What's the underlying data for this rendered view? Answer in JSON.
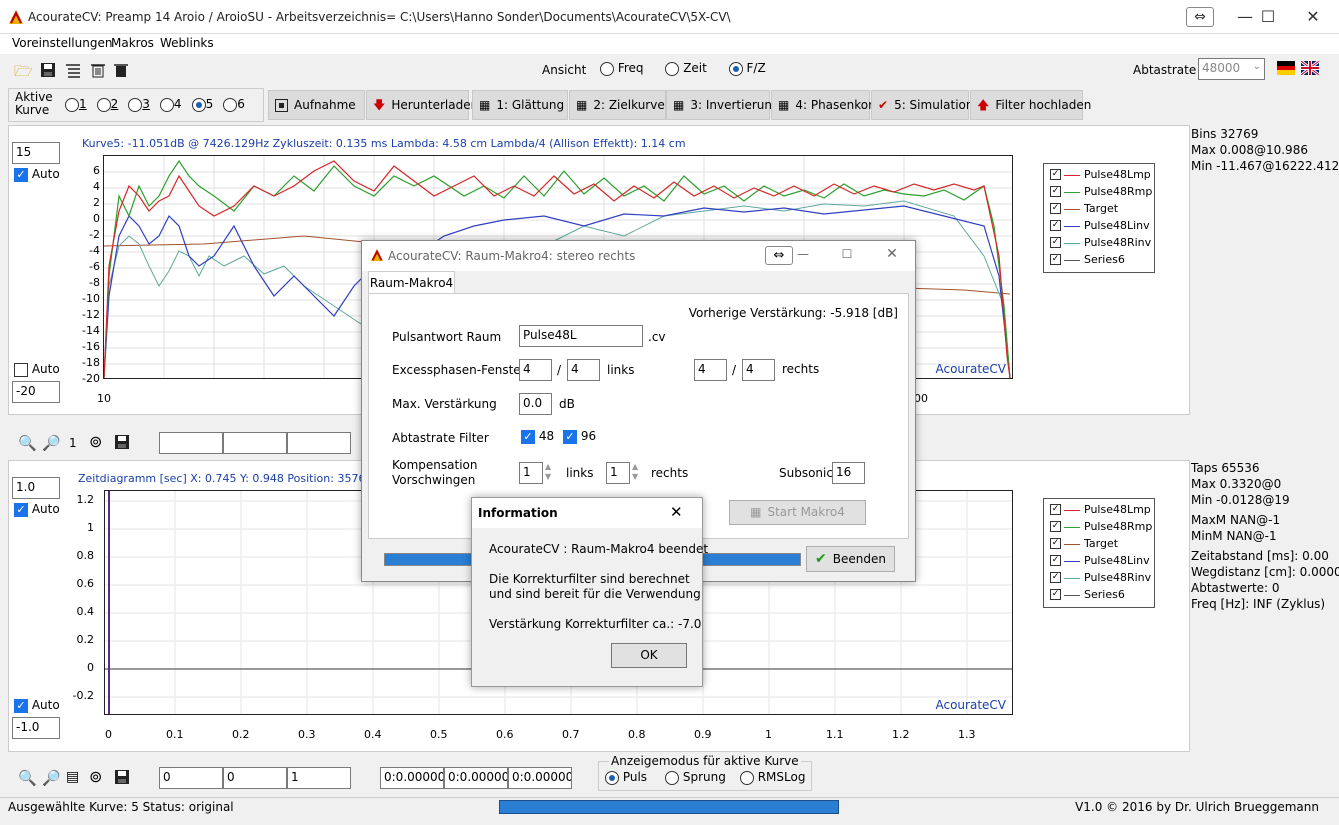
{
  "window": {
    "title": "AcourateCV:  Preamp 14 Aroio / AroioSU   -   Arbeitsverzeichnis= C:\\Users\\Hanno Sonder\\Documents\\AcourateCV\\5X-CV\\",
    "swap_icon": "⇔",
    "minimize": "—",
    "maximize": "☐",
    "close": "✕"
  },
  "menu": [
    "Voreinstellungen",
    "Makros",
    "Weblinks"
  ],
  "toolbar": {
    "ansicht_label": "Ansicht",
    "view_options": [
      "Freq",
      "Zeit",
      "F/Z"
    ],
    "view_selected": 2,
    "abtastrate_label": "Abtastrate",
    "abtastrate_value": "48000"
  },
  "aktive_kurve": {
    "label": "Aktive\nKurve",
    "options": [
      "1",
      "2",
      "3",
      "4",
      "5",
      "6"
    ],
    "selected": 4
  },
  "steps": [
    {
      "label": "Aufnahme",
      "icon": "record-icon"
    },
    {
      "label": "Herunterladen",
      "icon": "download-arrow-icon"
    },
    {
      "label": "1: Glättung",
      "icon": "calculator-icon"
    },
    {
      "label": "2: Zielkurve",
      "icon": "calculator-icon"
    },
    {
      "label": "3: Invertierung",
      "icon": "calculator-icon"
    },
    {
      "label": "4: Phasenkorr",
      "icon": "calculator-icon"
    },
    {
      "label": "5: Simulation",
      "icon": "checkmark-icon"
    },
    {
      "label": "Filter hochladen",
      "icon": "upload-arrow-icon"
    }
  ],
  "freq_panel": {
    "top_input": "15",
    "auto_top": "Auto",
    "auto_top_checked": true,
    "auto_bottom": "Auto",
    "auto_bottom_checked": false,
    "bottom_input": "-20",
    "header": "Kurve5:  -11.051dB @ 7426.129Hz   Zykluszeit: 0.135 ms    Lambda: 4.58 cm   Lambda/4 (Allison Effektt): 1.14 cm",
    "watermark": "AcourateCV",
    "y_ticks": [
      "6",
      "4",
      "2",
      "0",
      "-2",
      "-4",
      "-6",
      "-8",
      "-10",
      "-12",
      "-14",
      "-16",
      "-18",
      "-20"
    ],
    "x_ticks": [
      "10",
      "00"
    ],
    "info": [
      "Bins 32769",
      "Max 0.008@10.986",
      "Min -11.467@16222.412"
    ]
  },
  "legend": [
    {
      "name": "Pulse48Lmp",
      "color": "#d62728"
    },
    {
      "name": "Pulse48Rmp",
      "color": "#2ca02c"
    },
    {
      "name": "Target",
      "color": "#a0522d"
    },
    {
      "name": "Pulse48Linv",
      "color": "#3040c0"
    },
    {
      "name": "Pulse48Rinv",
      "color": "#5fa89a"
    },
    {
      "name": "Series6",
      "color": "#555555"
    }
  ],
  "mid_toolbar": {
    "zoom_value": "1"
  },
  "time_panel": {
    "top_input": "1.0",
    "auto_top": "Auto",
    "auto_top_checked": true,
    "auto_bottom": "Auto",
    "auto_bottom_checked": true,
    "bottom_input": "-1.0",
    "header": "Zeitdiagramm [sec]   X: 0.745   Y: 0.948   Position: 35766",
    "watermark": "AcourateCV",
    "y_ticks": [
      "1.2",
      "1",
      "0.8",
      "0.6",
      "0.4",
      "0.2",
      "0",
      "-0.2"
    ],
    "x_ticks": [
      "0",
      "0.1",
      "0.2",
      "0.3",
      "0.4",
      "0.5",
      "0.6",
      "0.7",
      "0.8",
      "0.9",
      "1",
      "1.1",
      "1.2",
      "1.3"
    ],
    "info": [
      "Taps 65536",
      "Max 0.3320@0",
      "Min -0.0128@19",
      "",
      "MaxM NAN@-1",
      "MinM NAN@-1",
      "",
      "Zeitabstand [ms]: 0.00",
      "Wegdistanz [cm]: 0.0000",
      "Abtastwerte:  0",
      "Freq [Hz]: INF (Zyklus)"
    ]
  },
  "bottom_toolbar": {
    "inputs_a": [
      "0",
      "0",
      "1"
    ],
    "inputs_b": [
      "0:0.00000",
      "0:0.00000",
      "0:0.00000"
    ],
    "anzeige_title": "Anzeigemodus für aktive Kurve",
    "anzeige_options": [
      "Puls",
      "Sprung",
      "RMSLog"
    ],
    "anzeige_selected": 0
  },
  "status": {
    "left": "Ausgewählte Kurve: 5   Status: original",
    "right": "V1.0 © 2016 by Dr. Ulrich Brueggemann"
  },
  "makro_dialog": {
    "title": "AcourateCV: Raum-Makro4: stereo rechts",
    "tab": "Raum-Makro4",
    "vorherige": "Vorherige Verstärkung: -5.918 [dB]",
    "puls_label": "Pulsantwort Raum",
    "puls_value": "Pulse48L",
    "puls_ext": ".cv",
    "excess_label": "Excessphasen-Fenster",
    "excess_l1": "4",
    "excess_l2": "4",
    "links": "links",
    "excess_r1": "4",
    "excess_r2": "4",
    "rechts": "rechts",
    "slash": "/",
    "maxverst_label": "Max. Verstärkung",
    "maxverst_value": "0.0",
    "db": "dB",
    "abtast_label": "Abtastrate Filter",
    "abtast_48": "48",
    "abtast_96": "96",
    "komp_label": "Kompensation\nVorschwingen",
    "komp_links": "1",
    "komp_rechts": "1",
    "subsonic_label": "Subsonic",
    "subsonic_value": "16",
    "start_button": "Start Makro4",
    "beenden_button": "Beenden",
    "progress": 1.0
  },
  "info_dialog": {
    "title": "Information",
    "line1": "AcourateCV :  Raum-Makro4 beendet",
    "line2": "Die Korrekturfilter sind berechnet",
    "line3": "und sind bereit für die Verwendung",
    "line4": "Verstärkung Korrekturfilter ca.: -7.0",
    "ok": "OK"
  }
}
